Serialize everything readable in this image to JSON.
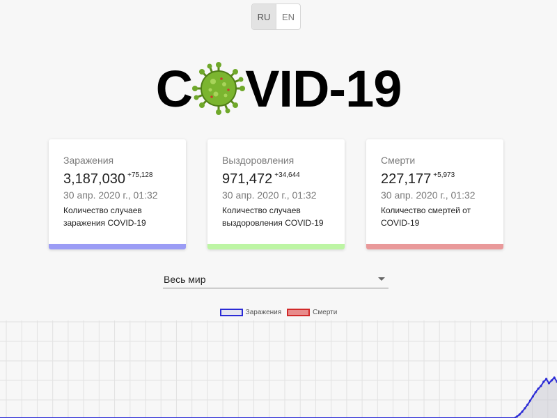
{
  "lang": {
    "options": [
      "RU",
      "EN"
    ],
    "active": "RU"
  },
  "title": {
    "left": "C",
    "right": "VID-19"
  },
  "cards": [
    {
      "label": "Заражения",
      "value": "3,187,030",
      "delta": "+75,128",
      "date": "30 апр. 2020 г., 01:32",
      "description": "Количество случаев заражения COVID-19",
      "color": "#9b9cf5"
    },
    {
      "label": "Выздоровления",
      "value": "971,472",
      "delta": "+34,644",
      "date": "30 апр. 2020 г., 01:32",
      "description": "Количество случаев выздоровления COVID-19",
      "color": "#bdf5a4"
    },
    {
      "label": "Смерти",
      "value": "227,177",
      "delta": "+5,973",
      "date": "30 апр. 2020 г., 01:32",
      "description": "Количество смертей от COVID-19",
      "color": "#e9999a"
    }
  ],
  "region_select": {
    "value": "Весь мир"
  },
  "legend": [
    {
      "label": "Заражения",
      "border": "#2b2bd6",
      "fill": "#e6e6f0"
    },
    {
      "label": "Смерти",
      "border": "#d12a2a",
      "fill": "#e88b8b"
    }
  ],
  "chart_data": {
    "type": "line",
    "series": [
      {
        "name": "Заражения",
        "color": "#2b2bd6",
        "values": [
          0,
          0,
          0,
          0,
          0,
          0,
          0,
          0,
          0,
          0,
          0,
          0,
          0,
          0,
          0,
          0,
          0,
          0,
          0,
          0,
          0,
          0,
          0,
          0,
          0,
          0,
          0,
          0,
          0,
          0,
          0,
          0,
          0,
          0,
          0,
          0,
          0,
          0,
          0,
          0,
          0,
          0,
          0,
          0,
          0,
          0,
          0,
          0,
          0,
          0,
          0,
          0,
          0,
          0,
          0,
          0,
          0,
          0,
          0,
          0,
          0,
          0,
          0,
          0,
          0,
          0,
          0,
          0,
          0,
          0,
          0,
          0,
          0,
          0,
          0,
          0,
          0,
          0,
          0,
          0,
          0,
          0,
          0,
          0,
          0,
          0,
          0,
          0,
          0,
          0,
          0,
          0,
          0,
          0,
          0,
          0,
          0,
          0,
          0,
          0,
          0,
          0,
          0,
          0,
          0,
          0,
          0,
          0,
          0,
          0,
          0,
          0,
          0,
          0,
          0,
          0,
          0,
          0,
          0,
          0,
          0,
          0,
          0,
          0,
          0,
          0,
          0,
          0,
          0,
          0,
          0,
          0,
          0,
          0,
          0,
          0,
          0,
          0,
          0,
          0,
          0,
          0,
          0,
          0,
          0,
          0,
          0,
          0,
          0,
          0,
          0,
          0,
          0,
          0,
          0,
          0,
          0,
          0,
          0,
          0,
          0,
          0,
          0,
          0,
          0,
          0,
          0,
          0,
          0,
          0,
          0,
          0,
          0,
          0,
          0,
          0,
          0,
          0,
          0,
          0,
          0,
          0,
          0,
          0,
          0,
          0,
          0,
          0,
          0,
          0,
          0,
          0,
          0,
          2,
          5,
          9,
          14,
          19,
          25,
          31,
          37,
          42,
          46,
          52,
          56,
          50,
          54,
          58,
          52
        ]
      }
    ],
    "grid": true
  }
}
